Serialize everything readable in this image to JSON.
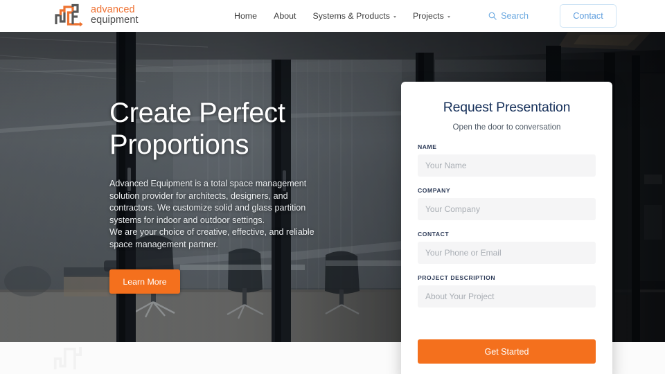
{
  "header": {
    "logo": {
      "line1": "advanced",
      "line2": "equipment",
      "icon": "advanced-equipment-logo"
    },
    "nav": [
      {
        "label": "Home",
        "has_caret": false
      },
      {
        "label": "About",
        "has_caret": false
      },
      {
        "label": "Systems & Products",
        "has_caret": true
      },
      {
        "label": "Projects",
        "has_caret": true
      }
    ],
    "search_label": "Search",
    "contact_label": "Contact",
    "accent_blue": "#5f9ede",
    "border_blue": "#cfe4f5"
  },
  "hero": {
    "title_line1": "Create Perfect",
    "title_line2": "Proportions",
    "paragraph_line1": "Advanced Equipment is a total space management",
    "paragraph_line2": "solution provider for architects, designers, and",
    "paragraph_line3": "contractors. We customize solid and glass partition",
    "paragraph_line4": "systems for indoor and outdoor settings.",
    "paragraph_line5": "We are your choice of creative, effective, and reliable",
    "paragraph_line6": "space management partner.",
    "cta_label": "Learn More",
    "cta_color": "#f4701d"
  },
  "form": {
    "title": "Request Presentation",
    "subtitle": "Open the door to conversation",
    "fields": [
      {
        "label": "NAME",
        "placeholder": "Your Name",
        "value": ""
      },
      {
        "label": "COMPANY",
        "placeholder": "Your Company",
        "value": ""
      },
      {
        "label": "CONTACT",
        "placeholder": "Your Phone or Email",
        "value": ""
      },
      {
        "label": "PROJECT DESCRIPTION",
        "placeholder": "About Your Project",
        "value": ""
      }
    ],
    "submit_label": "Get Started",
    "submit_color": "#f4701d",
    "title_color": "#16305a"
  }
}
